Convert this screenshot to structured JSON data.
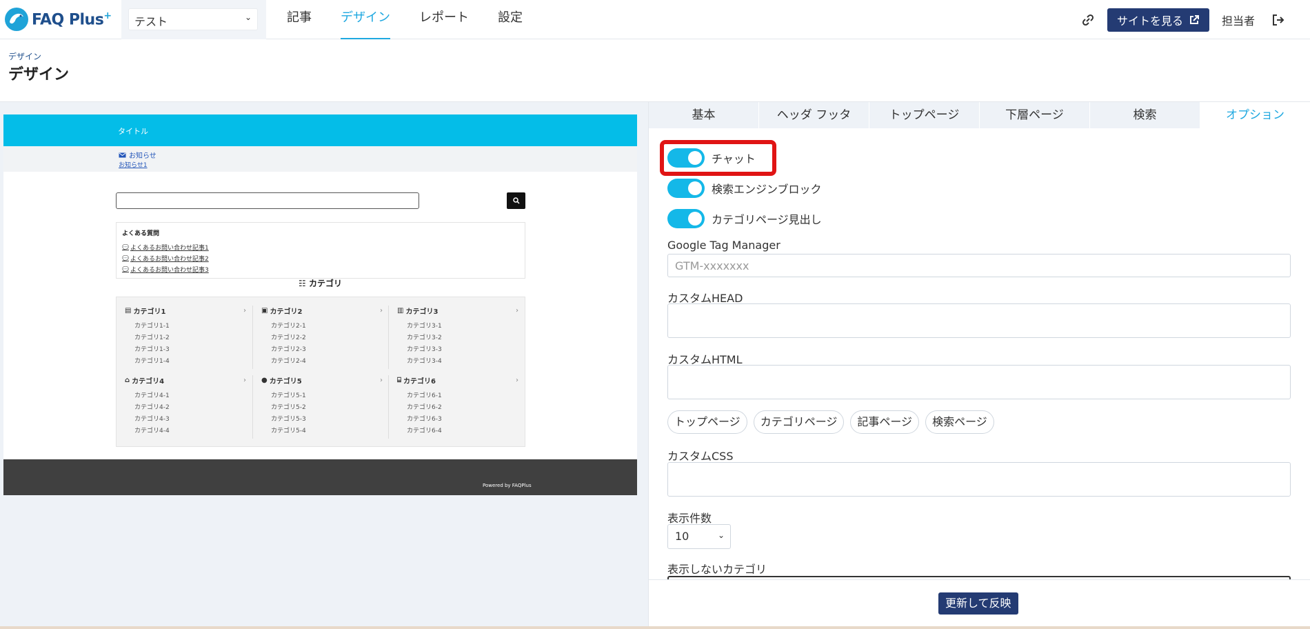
{
  "header": {
    "logo_text": "FAQ Plus",
    "logo_plus": "+",
    "site_select_value": "テスト",
    "nav": [
      "記事",
      "デザイン",
      "レポート",
      "設定"
    ],
    "view_site_label": "サイトを見る",
    "user_label": "担当者"
  },
  "page": {
    "breadcrumb": "デザイン",
    "title": "デザイン"
  },
  "preview": {
    "header_title": "タイトル",
    "news_heading": "お知らせ",
    "news_item": "お知らせ1",
    "faq_heading": "よくある質問",
    "faq_items": [
      "よくあるお問い合わせ記事1",
      "よくあるお問い合わせ記事2",
      "よくあるお問い合わせ記事3"
    ],
    "category_heading": "カテゴリ",
    "categories": [
      {
        "name": "カテゴリ1",
        "items": [
          "カテゴリ1-1",
          "カテゴリ1-2",
          "カテゴリ1-3",
          "カテゴリ1-4"
        ]
      },
      {
        "name": "カテゴリ2",
        "items": [
          "カテゴリ2-1",
          "カテゴリ2-2",
          "カテゴリ2-3",
          "カテゴリ2-4"
        ]
      },
      {
        "name": "カテゴリ3",
        "items": [
          "カテゴリ3-1",
          "カテゴリ3-2",
          "カテゴリ3-3",
          "カテゴリ3-4"
        ]
      },
      {
        "name": "カテゴリ4",
        "items": [
          "カテゴリ4-1",
          "カテゴリ4-2",
          "カテゴリ4-3",
          "カテゴリ4-4"
        ]
      },
      {
        "name": "カテゴリ5",
        "items": [
          "カテゴリ5-1",
          "カテゴリ5-2",
          "カテゴリ5-3",
          "カテゴリ5-4"
        ]
      },
      {
        "name": "カテゴリ6",
        "items": [
          "カテゴリ6-1",
          "カテゴリ6-2",
          "カテゴリ6-3",
          "カテゴリ6-4"
        ]
      }
    ],
    "footer_text": "Powered by FAQPlus"
  },
  "panel": {
    "tabs": [
      "基本",
      "ヘッダ フッタ",
      "トップページ",
      "下層ページ",
      "検索",
      "オプション"
    ],
    "toggles": [
      "チャット",
      "検索エンジンブロック",
      "カテゴリページ見出し"
    ],
    "gtm_label": "Google Tag Manager",
    "gtm_placeholder": "GTM-xxxxxxx",
    "custom_head_label": "カスタムHEAD",
    "custom_html_label": "カスタムHTML",
    "page_chips": [
      "トップページ",
      "カテゴリページ",
      "記事ページ",
      "検索ページ"
    ],
    "custom_css_label": "カスタムCSS",
    "display_count_label": "表示件数",
    "display_count_value": "10",
    "hidden_category_label": "表示しないカテゴリ",
    "update_button": "更新して反映"
  },
  "colors": {
    "accent": "#1fa8e0",
    "navy": "#243b73",
    "preview_header": "#04bde8",
    "highlight": "#e01414"
  }
}
